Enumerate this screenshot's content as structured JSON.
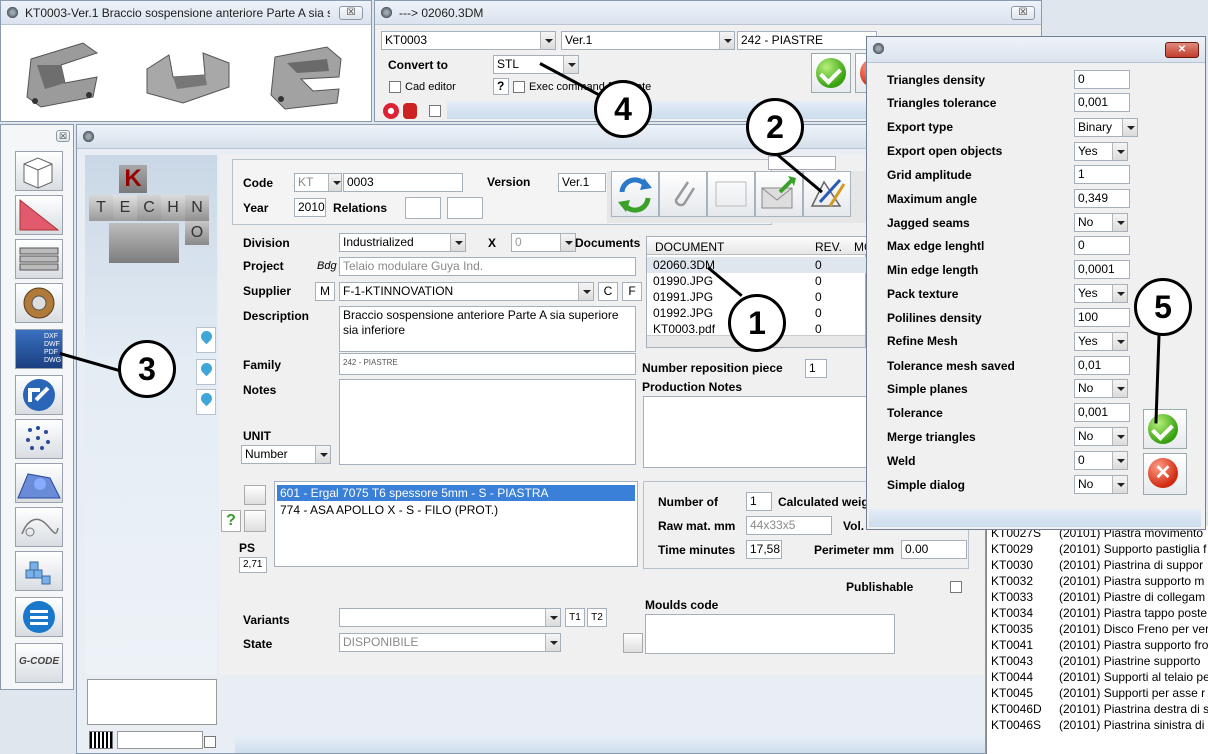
{
  "win_thumb": {
    "title": "KT0003-Ver.1 Braccio sospensione anteriore Parte A sia s...",
    "close": "☒"
  },
  "win_convert": {
    "title": "---> 02060.3DM",
    "code": "KT0003",
    "version": "Ver.1",
    "family": "242 - PIASTRE",
    "convert_label": "Convert to",
    "convert_value": "STL",
    "cad_editor": "Cad editor",
    "help": "?",
    "exec_cmd": "Exec command for quote",
    "close": "☒"
  },
  "left_panel": {
    "close": "☒",
    "gcode": "G-CODE"
  },
  "main": {
    "logo_letters": [
      "K",
      "T",
      "E",
      "C",
      "H",
      "N",
      "O"
    ],
    "code_label": "Code",
    "code_prefix": "KT",
    "code_value": "0003",
    "version_label": "Version",
    "version_value": "Ver.1",
    "year_label": "Year",
    "year_value": "2010",
    "relations_label": "Relations",
    "division_label": "Division",
    "division_value": "Industrialized",
    "x_label": "X",
    "x_value": "0",
    "documents_label": "Documents",
    "project_label": "Project",
    "project_prefix": "Bdg",
    "project_value": "Telaio modulare Guya Ind.",
    "supplier_label": "Supplier",
    "supplier_m": "M",
    "supplier_value": "F-1-KTINNOVATION",
    "supplier_c": "C",
    "supplier_f": "F",
    "description_label": "Description",
    "description_value": "Braccio sospensione anteriore Parte A sia superiore sia inferiore",
    "family_label": "Family",
    "family_value": "242 - PIASTRE",
    "notes_label": "Notes",
    "unit_label": "UNIT",
    "unit_value": "Number",
    "reposition_label": "Number reposition piece",
    "reposition_value": "1",
    "production_notes_label": "Production Notes",
    "materials": [
      "601 - Ergal 7075 T6 spessore 5mm - S - PIASTRA",
      "774 - ASA APOLLO X - S - FILO (PROT.)"
    ],
    "ps_label": "PS",
    "ps_value": "2,71",
    "number_of_label": "Number of",
    "number_of_value": "1",
    "calc_weight_label": "Calculated weig",
    "raw_mat_label": "Raw mat. mm",
    "raw_mat_value": "44x33x5",
    "vol_label": "Vol.",
    "time_label": "Time minutes",
    "time_value": "17,58",
    "perimeter_label": "Perimeter mm",
    "perimeter_value": "0.00",
    "publishable_label": "Publishable",
    "variants_label": "Variants",
    "t1": "T1",
    "t2": "T2",
    "state_label": "State",
    "state_value": "DISPONIBILE",
    "moulds_label": "Moulds code",
    "doc_headers": [
      "DOCUMENT",
      "REV.",
      "MO"
    ],
    "documents": [
      {
        "name": "02060.3DM",
        "rev": "0"
      },
      {
        "name": "01990.JPG",
        "rev": "0"
      },
      {
        "name": "01991.JPG",
        "rev": "0"
      },
      {
        "name": "01992.JPG",
        "rev": "0"
      },
      {
        "name": "KT0003.pdf",
        "rev": "0"
      }
    ]
  },
  "right_list": [
    {
      "code": "KT0027S",
      "desc": "(20101) Piastra movimento"
    },
    {
      "code": "KT0029",
      "desc": "(20101) Supporto pastiglia f"
    },
    {
      "code": "KT0030",
      "desc": "(20101) Piastrina di suppor"
    },
    {
      "code": "KT0032",
      "desc": "(20101) Piastra supporto m"
    },
    {
      "code": "KT0033",
      "desc": "(20101) Piastre di collegam"
    },
    {
      "code": "KT0034",
      "desc": "(20101) Piastra tappo poste"
    },
    {
      "code": "KT0035",
      "desc": "(20101) Disco Freno per ver"
    },
    {
      "code": "KT0041",
      "desc": "(20101) Piastra supporto fro"
    },
    {
      "code": "KT0043",
      "desc": "(20101) Piastrine supporto"
    },
    {
      "code": "KT0044",
      "desc": "(20101) Supporti al telaio pe"
    },
    {
      "code": "KT0045",
      "desc": "(20101) Supporti per asse r"
    },
    {
      "code": "KT0046D",
      "desc": "(20101) Piastrina destra di s"
    },
    {
      "code": "KT0046S",
      "desc": "(20101) Piastrina sinistra di"
    }
  ],
  "export_dialog": {
    "close": "✕",
    "params": [
      {
        "label": "Triangles density",
        "value": "0",
        "type": "text"
      },
      {
        "label": "Triangles tolerance",
        "value": "0,001",
        "type": "text"
      },
      {
        "label": "Export type",
        "value": "Binary",
        "type": "combo"
      },
      {
        "label": "Export open objects",
        "value": "Yes",
        "type": "combo"
      },
      {
        "label": "Grid amplitude",
        "value": "1",
        "type": "text"
      },
      {
        "label": "Maximum angle",
        "value": "0,349",
        "type": "text"
      },
      {
        "label": "Jagged seams",
        "value": "No",
        "type": "combo"
      },
      {
        "label": "Max edge lenghtl",
        "value": "0",
        "type": "text"
      },
      {
        "label": "Min edge length",
        "value": "0,0001",
        "type": "text"
      },
      {
        "label": "Pack texture",
        "value": "Yes",
        "type": "combo"
      },
      {
        "label": "Polilines density",
        "value": "100",
        "type": "text"
      },
      {
        "label": "Refine Mesh",
        "value": "Yes",
        "type": "combo"
      },
      {
        "label": "Tolerance mesh saved",
        "value": "0,01",
        "type": "text"
      },
      {
        "label": "Simple planes",
        "value": "No",
        "type": "combo"
      },
      {
        "label": "Tolerance",
        "value": "0,001",
        "type": "text"
      },
      {
        "label": "Merge triangles",
        "value": "No",
        "type": "combo"
      },
      {
        "label": "Weld",
        "value": "0",
        "type": "combo"
      },
      {
        "label": "Simple dialog",
        "value": "No",
        "type": "combo"
      }
    ]
  },
  "callouts": [
    "1",
    "2",
    "3",
    "4",
    "5"
  ]
}
